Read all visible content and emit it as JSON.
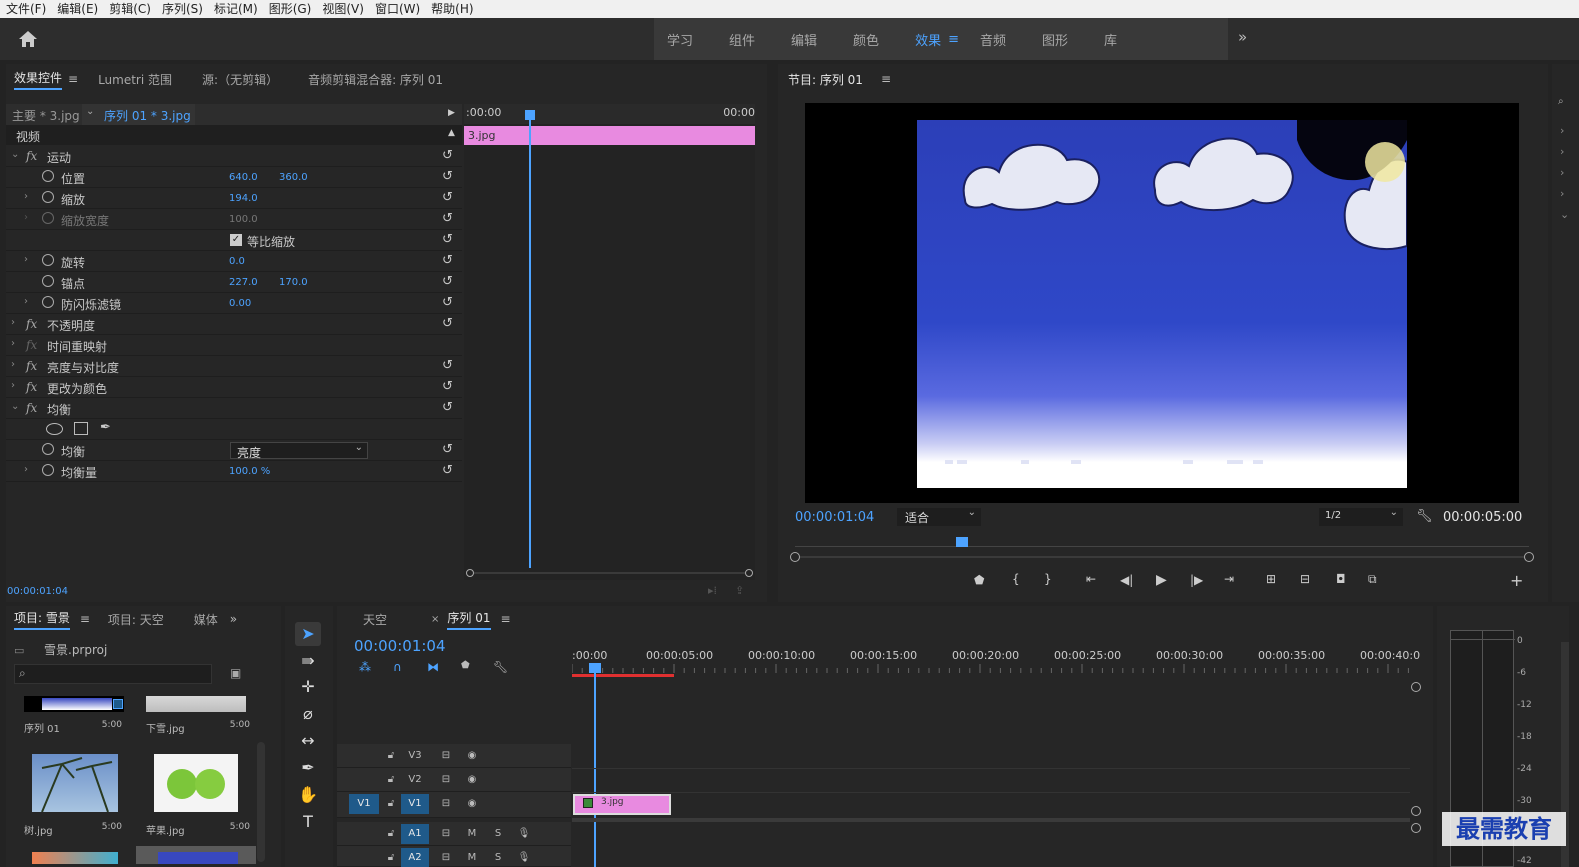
{
  "menu": [
    "文件(F)",
    "编辑(E)",
    "剪辑(C)",
    "序列(S)",
    "标记(M)",
    "图形(G)",
    "视图(V)",
    "窗口(W)",
    "帮助(H)"
  ],
  "workspaces": [
    "学习",
    "组件",
    "编辑",
    "颜色",
    "效果",
    "音频",
    "图形",
    "库"
  ],
  "workspace_active": "效果",
  "effects_panel": {
    "tabs": [
      "效果控件",
      "Lumetri 范围",
      "源:（无剪辑）",
      "音频剪辑混合器: 序列 01"
    ],
    "master_clip": "主要 * 3.jpg",
    "sequence_clip": "序列 01 * 3.jpg",
    "section_video": "视频",
    "ruler_start": ":00:00",
    "ruler_end": "00:00",
    "clip_name": "3.jpg",
    "timecode": "00:00:01:04",
    "rows": {
      "motion": "运动",
      "position": "位置",
      "position_x": "640.0",
      "position_y": "360.0",
      "scale": "缩放",
      "scale_v": "194.0",
      "scale_width": "缩放宽度",
      "scale_width_v": "100.0",
      "uniform_scale": "等比缩放",
      "rotation": "旋转",
      "rotation_v": "0.0",
      "anchor": "锚点",
      "anchor_x": "227.0",
      "anchor_y": "170.0",
      "antiflicker": "防闪烁滤镜",
      "antiflicker_v": "0.00",
      "opacity": "不透明度",
      "time_remap": "时间重映射",
      "brightness": "亮度与对比度",
      "change_color": "更改为颜色",
      "equalize": "均衡",
      "equalize_param": "均衡",
      "equalize_select": "亮度",
      "equalize_amount": "均衡量",
      "equalize_amount_v": "100.0 %"
    }
  },
  "program_panel": {
    "title": "节目: 序列 01",
    "timecode": "00:00:01:04",
    "fit": "适合",
    "resolution": "1/2",
    "duration": "00:00:05:00"
  },
  "project_panel": {
    "tabs": [
      "项目: 雪景",
      "项目: 天空",
      "媒体"
    ],
    "file": "雪景.prproj",
    "items": [
      {
        "name": "序列 01",
        "dur": "5:00"
      },
      {
        "name": "下雪.jpg",
        "dur": "5:00"
      },
      {
        "name": "树.jpg",
        "dur": "5:00"
      },
      {
        "name": "苹果.jpg",
        "dur": "5:00"
      }
    ]
  },
  "timeline_panel": {
    "tabs": [
      "天空",
      "序列 01"
    ],
    "timecode": "00:00:01:04",
    "ruler": [
      ":00:00",
      "00:00:05:00",
      "00:00:10:00",
      "00:00:15:00",
      "00:00:20:00",
      "00:00:25:00",
      "00:00:30:00",
      "00:00:35:00",
      "00:00:40:0"
    ],
    "clip_name": "3.jpg",
    "tracks": [
      "V3",
      "V2",
      "V1",
      "A1",
      "A2"
    ],
    "source_v1": "V1",
    "mute": "M",
    "solo": "S"
  },
  "meter": {
    "ticks": [
      "0",
      "-6",
      "-12",
      "-18",
      "-24",
      "-30",
      "-42"
    ]
  },
  "watermark": "最需教育",
  "colors": {
    "accent": "#4da3ff",
    "clip": "#e88ae0",
    "panel": "#262626"
  }
}
